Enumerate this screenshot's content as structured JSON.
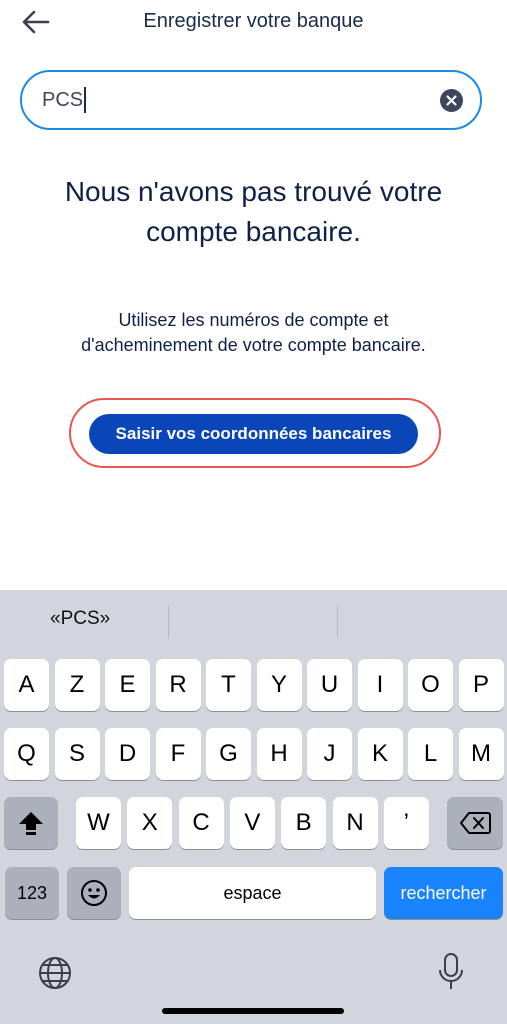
{
  "header": {
    "title": "Enregistrer votre banque",
    "back_icon": "back-arrow-icon"
  },
  "search": {
    "value": "PCS",
    "clear_icon": "clear-circle-x-icon",
    "border_color": "#1a8ce6"
  },
  "message": {
    "title": "Nous n'avons pas trouvé votre compte bancaire.",
    "description": "Utilisez les numéros de compte et d'acheminement de votre compte bancaire."
  },
  "cta": {
    "label": "Saisir vos coordonnées bancaires",
    "color": "#0a46b8",
    "highlight_color": "#e8574f"
  },
  "keyboard": {
    "suggestions": [
      "«PCS»",
      "",
      ""
    ],
    "row1": [
      "A",
      "Z",
      "E",
      "R",
      "T",
      "Y",
      "U",
      "I",
      "O",
      "P"
    ],
    "row2": [
      "Q",
      "S",
      "D",
      "F",
      "G",
      "H",
      "J",
      "K",
      "L",
      "M"
    ],
    "row3": [
      "W",
      "X",
      "C",
      "V",
      "B",
      "N",
      "’"
    ],
    "shift_icon": "shift-icon",
    "delete_icon": "backspace-icon",
    "numbers_label": "123",
    "emoji_icon": "emoji-icon",
    "space_label": "espace",
    "action_label": "rechercher",
    "action_color": "#1a84ff",
    "globe_icon": "globe-icon",
    "mic_icon": "microphone-icon"
  }
}
